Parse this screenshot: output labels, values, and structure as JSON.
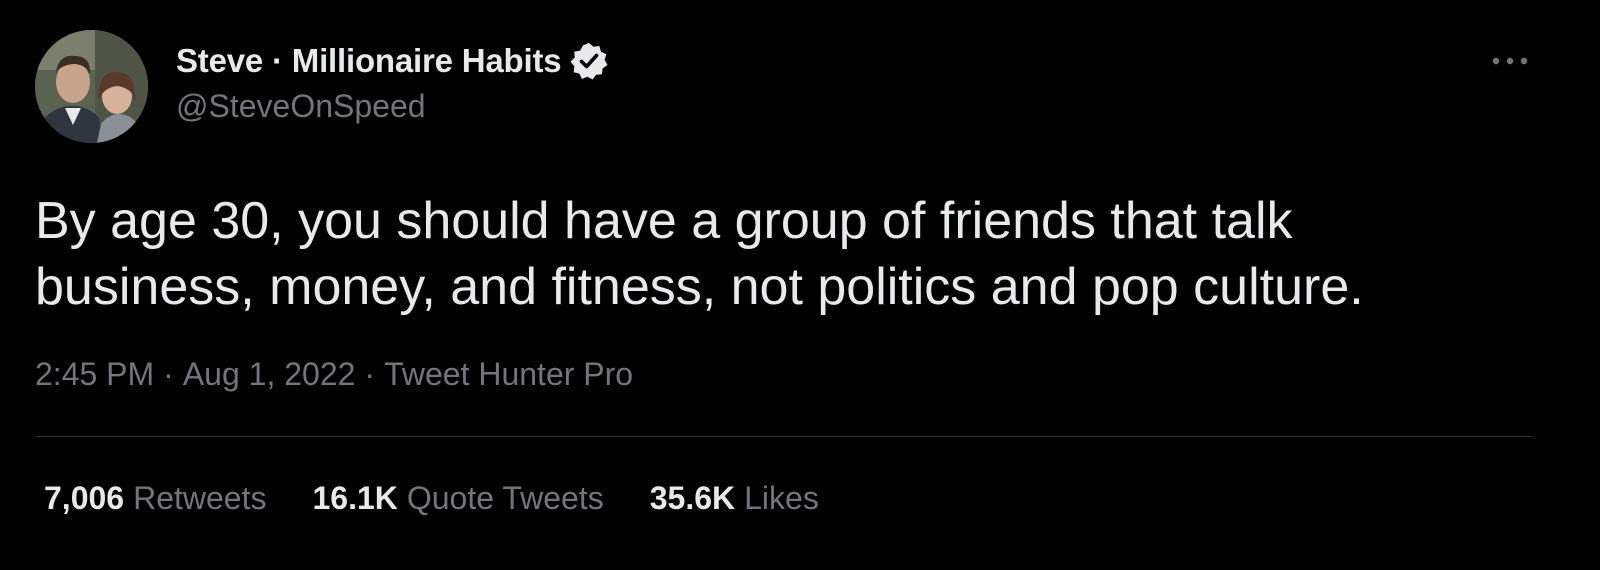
{
  "author": {
    "display_name": "Steve · Millionaire Habits",
    "handle": "@SteveOnSpeed",
    "verified": true,
    "verified_icon": "verified-badge-icon",
    "avatar_icon": "profile-photo"
  },
  "more_icon": "more-options-icon",
  "tweet": {
    "lines": [
      "By age 30, you should have a group of friends that talk",
      "business, money, and fitness, not politics and pop culture."
    ]
  },
  "meta": {
    "time": "2:45 PM",
    "separator": "·",
    "date": "Aug 1, 2022",
    "source": "Tweet Hunter Pro"
  },
  "stats": {
    "retweets": {
      "count": "7,006",
      "label": "Retweets"
    },
    "quote_tweets": {
      "count": "16.1K",
      "label": "Quote Tweets"
    },
    "likes": {
      "count": "35.6K",
      "label": "Likes"
    }
  },
  "colors": {
    "background": "#000000",
    "primary_text": "#e7e9ea",
    "secondary_text": "#71767b",
    "divider": "#2f3336"
  }
}
